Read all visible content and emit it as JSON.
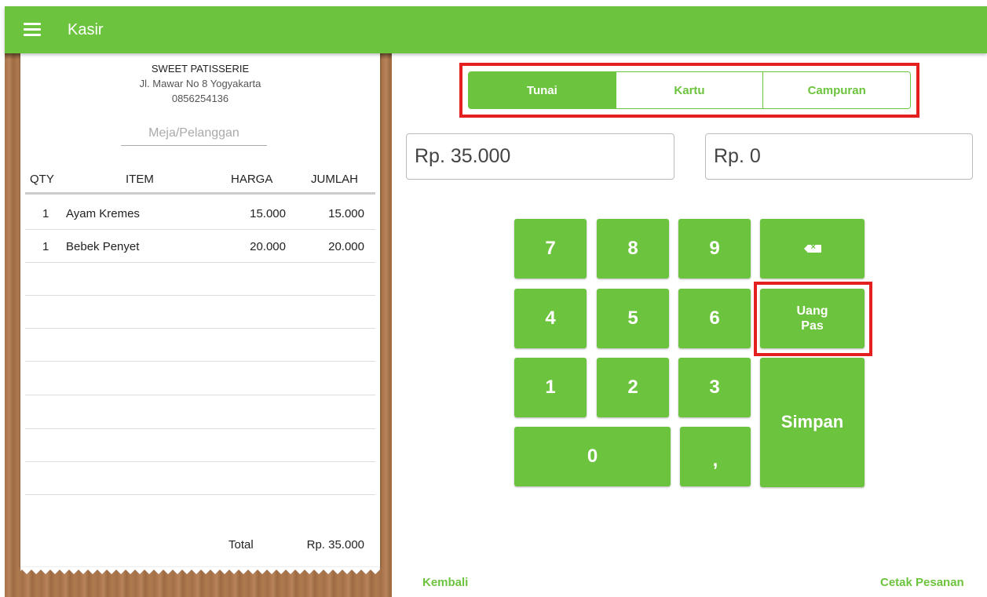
{
  "appbar": {
    "title": "Kasir",
    "menu_icon": "hamburger-menu-icon"
  },
  "receipt": {
    "shop_name": "SWEET PATISSERIE",
    "address": "Jl. Mawar No 8 Yogyakarta",
    "phone": "0856254136",
    "customer_placeholder": "Meja/Pelanggan",
    "columns": {
      "qty": "QTY",
      "item": "ITEM",
      "harga": "HARGA",
      "jumlah": "JUMLAH"
    },
    "items": [
      {
        "qty": "1",
        "name": "Ayam Kremes",
        "harga": "15.000",
        "jumlah": "15.000"
      },
      {
        "qty": "1",
        "name": "Bebek Penyet",
        "harga": "20.000",
        "jumlah": "20.000"
      }
    ],
    "total_label": "Total",
    "total_value": "Rp. 35.000"
  },
  "payment": {
    "tabs": [
      {
        "label": "Tunai",
        "active": true
      },
      {
        "label": "Kartu",
        "active": false
      },
      {
        "label": "Campuran",
        "active": false
      }
    ],
    "amount_due": "Rp. 35.000",
    "amount_paid": "Rp. 0"
  },
  "keypad": {
    "k7": "7",
    "k8": "8",
    "k9": "9",
    "k4": "4",
    "k5": "5",
    "k6": "6",
    "k1": "1",
    "k2": "2",
    "k3": "3",
    "k0": "0",
    "comma": ",",
    "backspace_icon": "backspace-icon",
    "exact_line1": "Uang",
    "exact_line2": "Pas",
    "save": "Simpan"
  },
  "footer": {
    "back": "Kembali",
    "print": "Cetak Pesanan"
  },
  "colors": {
    "primary": "#6cc33d",
    "highlight": "#e41f1f",
    "wood": "#a9744a"
  }
}
